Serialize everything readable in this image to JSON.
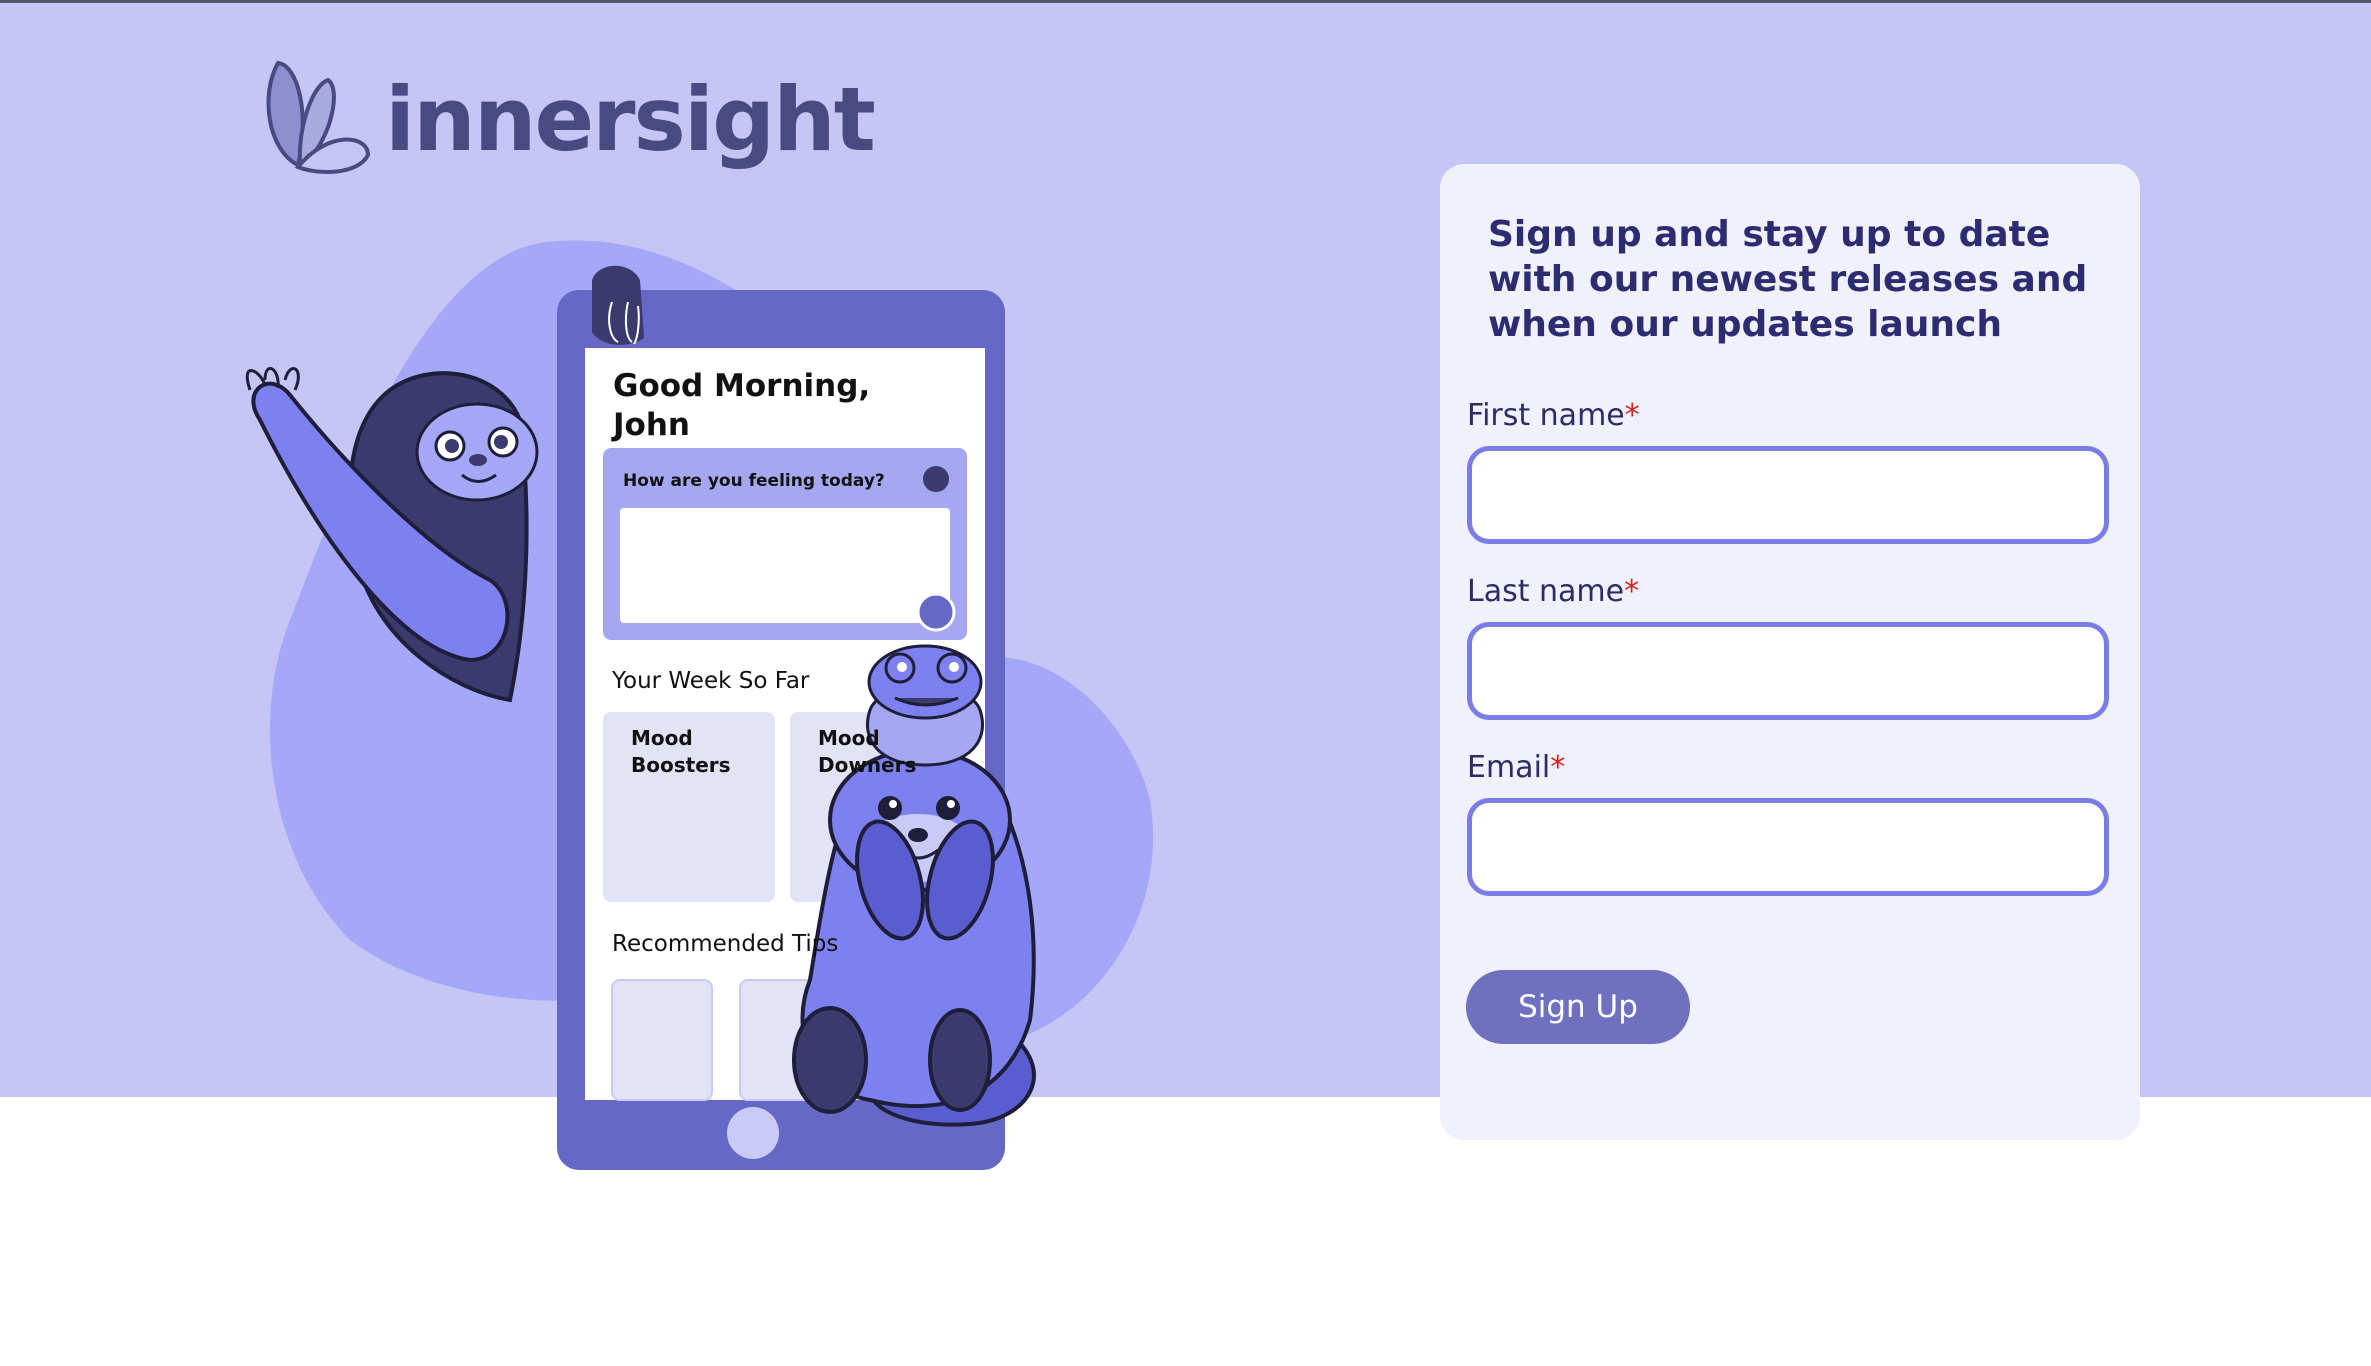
{
  "brand": {
    "name": "innersight",
    "logo_icon": "butterfly-icon",
    "color": "#4a4a82"
  },
  "colors": {
    "hero_background": "#c5c6f5",
    "card_background": "#f1f1fb",
    "accent": "#7a7de8",
    "button": "#6f71c0",
    "heading": "#2c2c72",
    "required": "#d02020"
  },
  "phone": {
    "greeting": "Good Morning, John",
    "question": "How are you feeling today?",
    "week_heading": "Your Week So Far",
    "cards": [
      "Mood Boosters",
      "Mood Downers"
    ],
    "tips_heading": "Recommended Tips"
  },
  "signup": {
    "heading": "Sign up and stay up to date with our newest releases and when our updates launch",
    "required_marker": "*",
    "fields": [
      {
        "label": "First name",
        "value": ""
      },
      {
        "label": "Last name",
        "value": ""
      },
      {
        "label": "Email",
        "value": ""
      }
    ],
    "button_label": "Sign Up"
  }
}
